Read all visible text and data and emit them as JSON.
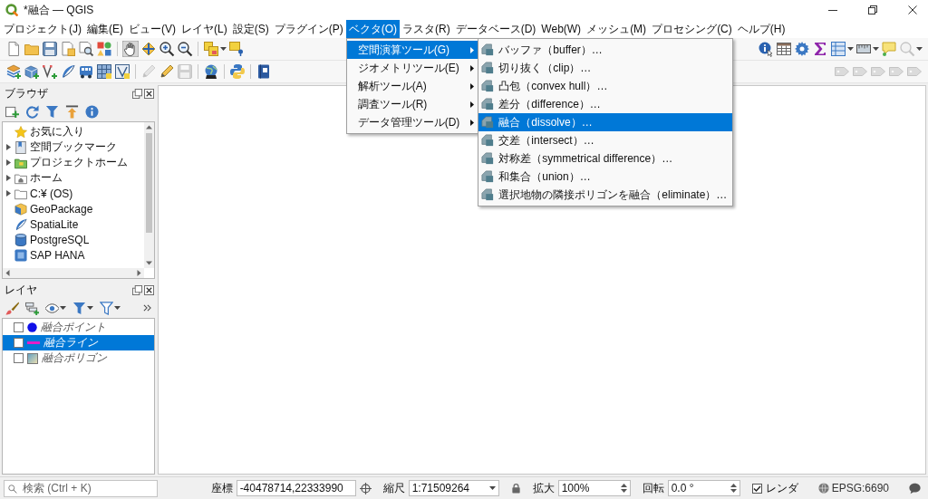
{
  "window": {
    "title": "*融合 — QGIS"
  },
  "menu_bar": [
    {
      "label": "プロジェクト(J)",
      "selected": false
    },
    {
      "label": "編集(E)",
      "selected": false
    },
    {
      "label": "ビュー(V)",
      "selected": false
    },
    {
      "label": "レイヤ(L)",
      "selected": false
    },
    {
      "label": "設定(S)",
      "selected": false
    },
    {
      "label": "プラグイン(P)",
      "selected": false
    },
    {
      "label": "ベクタ(O)",
      "selected": true
    },
    {
      "label": "ラスタ(R)",
      "selected": false
    },
    {
      "label": "データベース(D)",
      "selected": false
    },
    {
      "label": "Web(W)",
      "selected": false
    },
    {
      "label": "メッシュ(M)",
      "selected": false
    },
    {
      "label": "プロセシング(C)",
      "selected": false
    },
    {
      "label": "ヘルプ(H)",
      "selected": false
    }
  ],
  "vector_menu": [
    {
      "label": "空間演算ツール(G)",
      "selected": true
    },
    {
      "label": "ジオメトリツール(E)",
      "selected": false
    },
    {
      "label": "解析ツール(A)",
      "selected": false
    },
    {
      "label": "調査ツール(R)",
      "selected": false
    },
    {
      "label": "データ管理ツール(D)",
      "selected": false
    }
  ],
  "geoprocessing_submenu": [
    {
      "label": "バッファ（buffer）…",
      "selected": false
    },
    {
      "label": "切り抜く（clip）…",
      "selected": false
    },
    {
      "label": "凸包（convex hull）…",
      "selected": false
    },
    {
      "label": "差分（difference）…",
      "selected": false
    },
    {
      "label": "融合（dissolve）…",
      "selected": true
    },
    {
      "label": "交差（intersect）…",
      "selected": false
    },
    {
      "label": "対称差（symmetrical difference）…",
      "selected": false
    },
    {
      "label": "和集合（union）…",
      "selected": false
    },
    {
      "label": "選択地物の隣接ポリゴンを融合（eliminate）…",
      "selected": false
    }
  ],
  "toolbars": [
    {
      "left": [
        [
          {
            "kind": "new",
            "disabled": false
          },
          {
            "kind": "open",
            "disabled": false
          },
          {
            "kind": "save",
            "disabled": false
          },
          {
            "kind": "saveas",
            "disabled": false
          },
          {
            "kind": "layout",
            "disabled": false
          },
          {
            "kind": "style",
            "disabled": false
          }
        ],
        [
          {
            "kind": "pan",
            "selected": true,
            "disabled": false
          },
          {
            "kind": "panselect",
            "selected": false,
            "disabled": false
          },
          {
            "kind": "zoomin",
            "selected": false,
            "disabled": false
          },
          {
            "kind": "zoomout",
            "selected": false,
            "disabled": false
          }
        ],
        [
          {
            "kind": "select",
            "disabled": false,
            "dropdown": true
          },
          {
            "kind": "selectloc",
            "disabled": false
          }
        ]
      ],
      "right": [
        [
          {
            "kind": "identify",
            "disabled": false
          },
          {
            "kind": "attrtable",
            "disabled": false
          },
          {
            "kind": "toolbox",
            "disabled": false
          },
          {
            "kind": "stats",
            "disabled": false
          },
          {
            "kind": "fieldcalc",
            "disabled": false,
            "dropdown": true
          },
          {
            "kind": "measure",
            "disabled": false,
            "dropdown": true
          },
          {
            "kind": "maptip",
            "disabled": false
          },
          {
            "kind": "search",
            "disabled": true,
            "dropdown": true
          }
        ]
      ]
    },
    {
      "left": [
        [
          {
            "kind": "newgpkg",
            "disabled": false
          },
          {
            "kind": "newshape",
            "disabled": false
          },
          {
            "kind": "newline",
            "disabled": false
          },
          {
            "kind": "feather",
            "disabled": false
          },
          {
            "kind": "bus",
            "disabled": false
          },
          {
            "kind": "grid",
            "disabled": false
          },
          {
            "kind": "vsquare",
            "disabled": false
          }
        ],
        [
          {
            "kind": "pencil",
            "disabled": true
          },
          {
            "kind": "editpencil",
            "disabled": false
          },
          {
            "kind": "saveedits",
            "disabled": true
          }
        ],
        [
          {
            "kind": "globe",
            "disabled": false
          }
        ],
        [
          {
            "kind": "python",
            "disabled": false
          }
        ],
        [
          {
            "kind": "book",
            "disabled": false
          }
        ]
      ],
      "right": [
        [
          {
            "kind": "label",
            "disabled": true
          },
          {
            "kind": "label",
            "disabled": true
          },
          {
            "kind": "label",
            "disabled": true
          },
          {
            "kind": "label",
            "disabled": true
          },
          {
            "kind": "label",
            "disabled": true
          }
        ]
      ]
    }
  ],
  "browser_panel": {
    "title": "ブラウザ",
    "items": [
      {
        "label": "お気に入り",
        "kind": "favorites",
        "expandable": false,
        "expanded": false
      },
      {
        "label": "空間ブックマーク",
        "kind": "bookmarks",
        "expandable": true,
        "expanded": false
      },
      {
        "label": "プロジェクトホーム",
        "kind": "projecthome",
        "expandable": true,
        "expanded": false
      },
      {
        "label": "ホーム",
        "kind": "home",
        "expandable": true,
        "expanded": false
      },
      {
        "label": "C:¥ (OS)",
        "kind": "drive",
        "expandable": true,
        "expanded": false
      },
      {
        "label": "GeoPackage",
        "kind": "geopackage",
        "expandable": false,
        "expanded": false
      },
      {
        "label": "SpatiaLite",
        "kind": "spatialite",
        "expandable": false,
        "expanded": false
      },
      {
        "label": "PostgreSQL",
        "kind": "postgresql",
        "expandable": false,
        "expanded": false
      },
      {
        "label": "SAP HANA",
        "kind": "saphana",
        "expandable": false,
        "expanded": false
      }
    ]
  },
  "layers_panel": {
    "title": "レイヤ",
    "layers": [
      {
        "name": "融合ポイント",
        "kind": "point",
        "color": "#1010e8",
        "checked": false,
        "selected": false
      },
      {
        "name": "融合ライン",
        "kind": "line",
        "color": "#e41ec8",
        "checked": false,
        "selected": true
      },
      {
        "name": "融合ポリゴン",
        "kind": "polygon",
        "checked": false,
        "selected": false
      }
    ]
  },
  "status_bar": {
    "search": {
      "placeholder": "検索 (Ctrl + K)"
    },
    "coordinate": {
      "label": "座標",
      "value": "-40478714,22333990"
    },
    "scale": {
      "label": "縮尺",
      "value": "1:71509264"
    },
    "magnifier": {
      "label": "拡大",
      "value": "100%"
    },
    "rotation": {
      "label": "回転",
      "value": "0.0 °"
    },
    "render": {
      "label": "レンダ",
      "checked": true
    },
    "crs": "EPSG:6690"
  }
}
